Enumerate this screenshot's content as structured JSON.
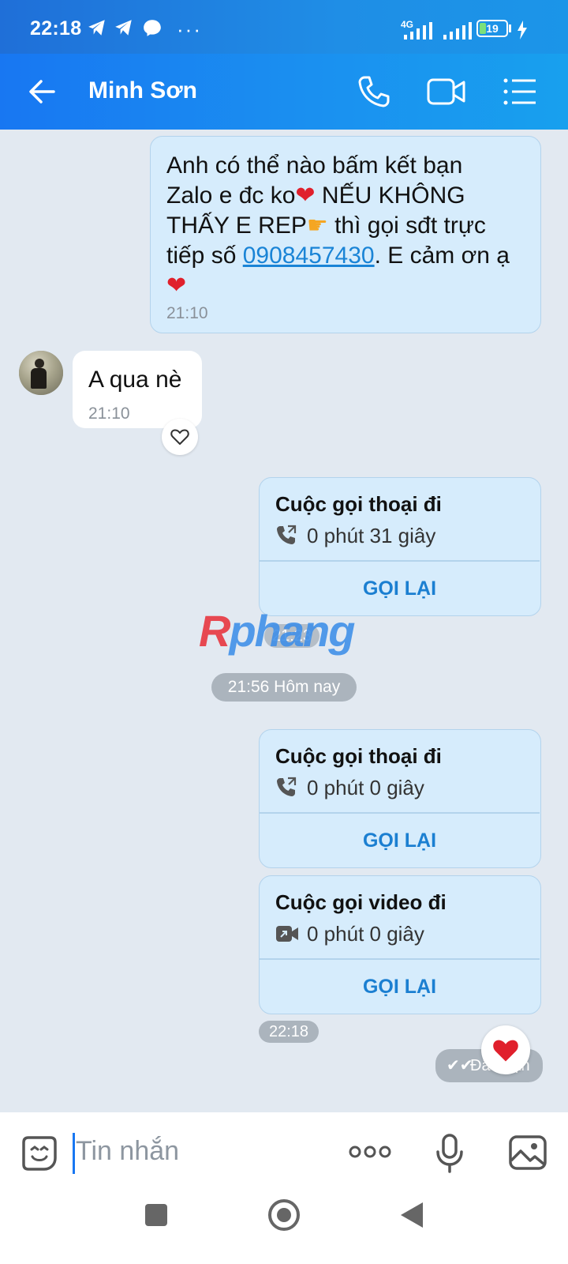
{
  "status_bar": {
    "time": "22:18",
    "battery": "19",
    "network": "4G",
    "icons": [
      "telegram-icon",
      "telegram-icon",
      "messenger-icon",
      "more-dots-icon"
    ]
  },
  "header": {
    "contact_name": "Minh Sơn",
    "icons": [
      "back-arrow-icon",
      "phone-icon",
      "video-camera-icon",
      "menu-list-icon"
    ]
  },
  "messages": {
    "outgoing_text": {
      "line1": "Anh có thể nào bấm kết bạn",
      "line2_prefix": "Zalo e đc ko",
      "line2_suffix": " NẾU KHÔNG",
      "line3_prefix": "THẤY E REP",
      "line3_suffix": " thì gọi sđt trực",
      "line4_prefix": "tiếp số ",
      "phone": "0908457430",
      "line4_suffix": ". E cảm ơn ạ",
      "time": "21:10"
    },
    "incoming_text": {
      "text": "A qua nè",
      "time": "21:10"
    },
    "call1": {
      "title": "Cuộc gọi thoại đi",
      "duration": "0 phút 31 giây",
      "action": "GỌI LẠI",
      "time": "21:23"
    },
    "date_separator": "21:56 Hôm nay",
    "call2": {
      "title": "Cuộc gọi thoại đi",
      "duration": "0 phút 0 giây",
      "action": "GỌI LẠI"
    },
    "call3": {
      "title": "Cuộc gọi video đi",
      "duration": "0 phút 0 giây",
      "action": "GỌI LẠI",
      "time": "22:18"
    },
    "seen_status": "Đã nhận"
  },
  "watermark": "Rphang",
  "composer": {
    "placeholder": "Tin nhắn",
    "icons": [
      "sticker-icon",
      "more-options-icon",
      "microphone-icon",
      "image-icon"
    ]
  },
  "nav": {
    "icons": [
      "recent-apps-icon",
      "home-icon",
      "back-icon"
    ]
  },
  "colors": {
    "header": "#1877f2",
    "outgoing_bubble": "#d6ecfc",
    "incoming_bubble": "#ffffff",
    "background": "#e2e9f1",
    "link": "#1a84d6"
  }
}
